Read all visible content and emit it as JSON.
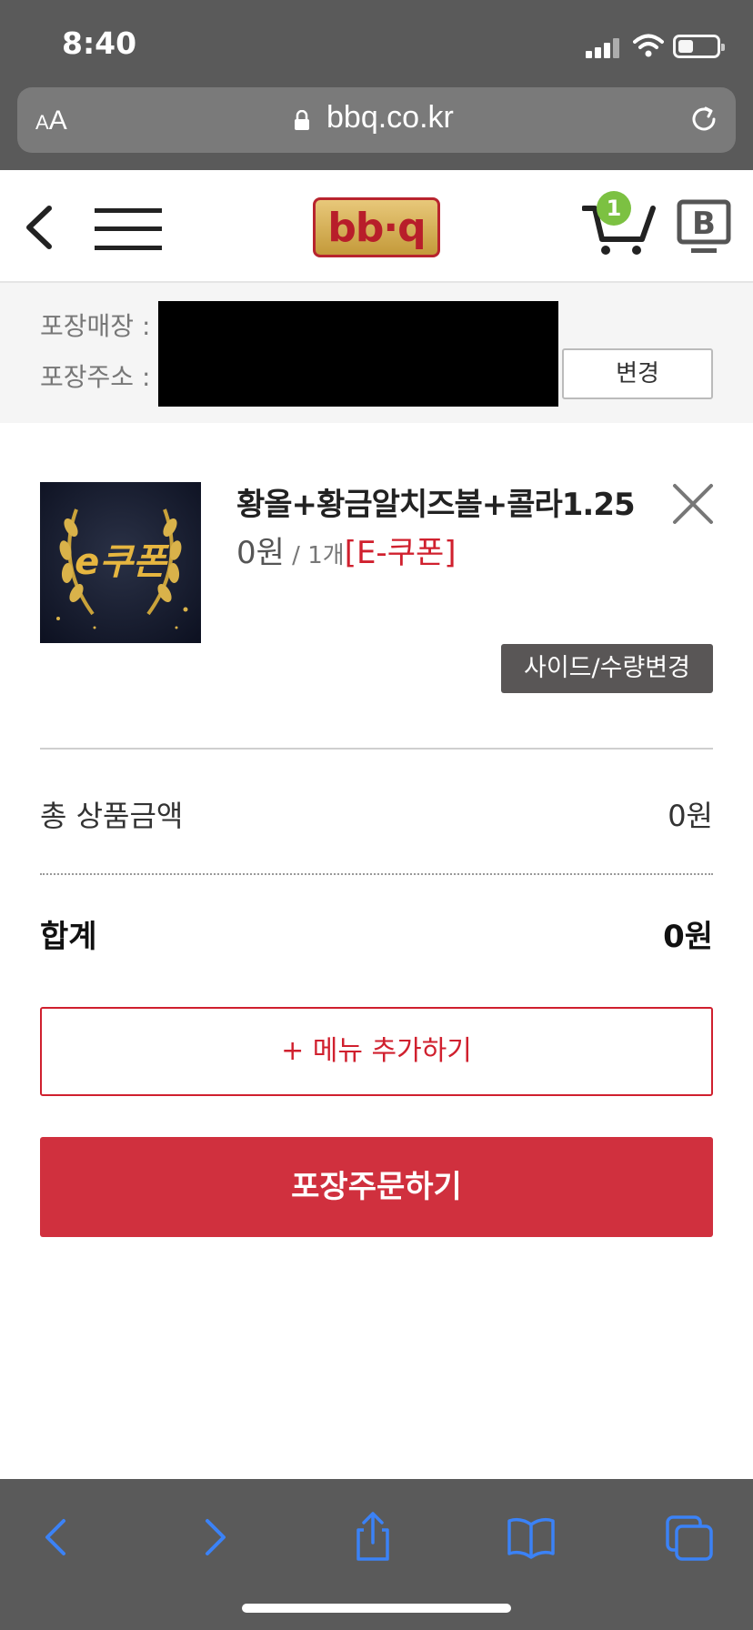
{
  "status_bar": {
    "time": "8:40"
  },
  "browser": {
    "text_size_label_small": "A",
    "text_size_label_large": "A",
    "url": "bbq.co.kr"
  },
  "header": {
    "logo_text": "bb·q",
    "cart_count": "1"
  },
  "pickup": {
    "store_label": "포장매장 :",
    "address_label": "포장주소 :",
    "change_button": "변경"
  },
  "cart_item": {
    "thumbnail_text": "e쿠폰",
    "name": "황올+황금알치즈볼+콜라1.25",
    "price": "0원",
    "quantity": " / 1개",
    "coupon_tag": "[E-쿠폰]",
    "options_button": "사이드/수량변경"
  },
  "summary": {
    "subtotal_label": "총 상품금액",
    "subtotal_value": "0원",
    "total_label": "합계",
    "total_value": "0원"
  },
  "actions": {
    "add_menu_button": "+ 메뉴 추가하기",
    "order_button": "포장주문하기"
  },
  "colors": {
    "brand_red": "#d0303e",
    "badge_green": "#7cc142",
    "safari_blue": "#3b82f6"
  }
}
